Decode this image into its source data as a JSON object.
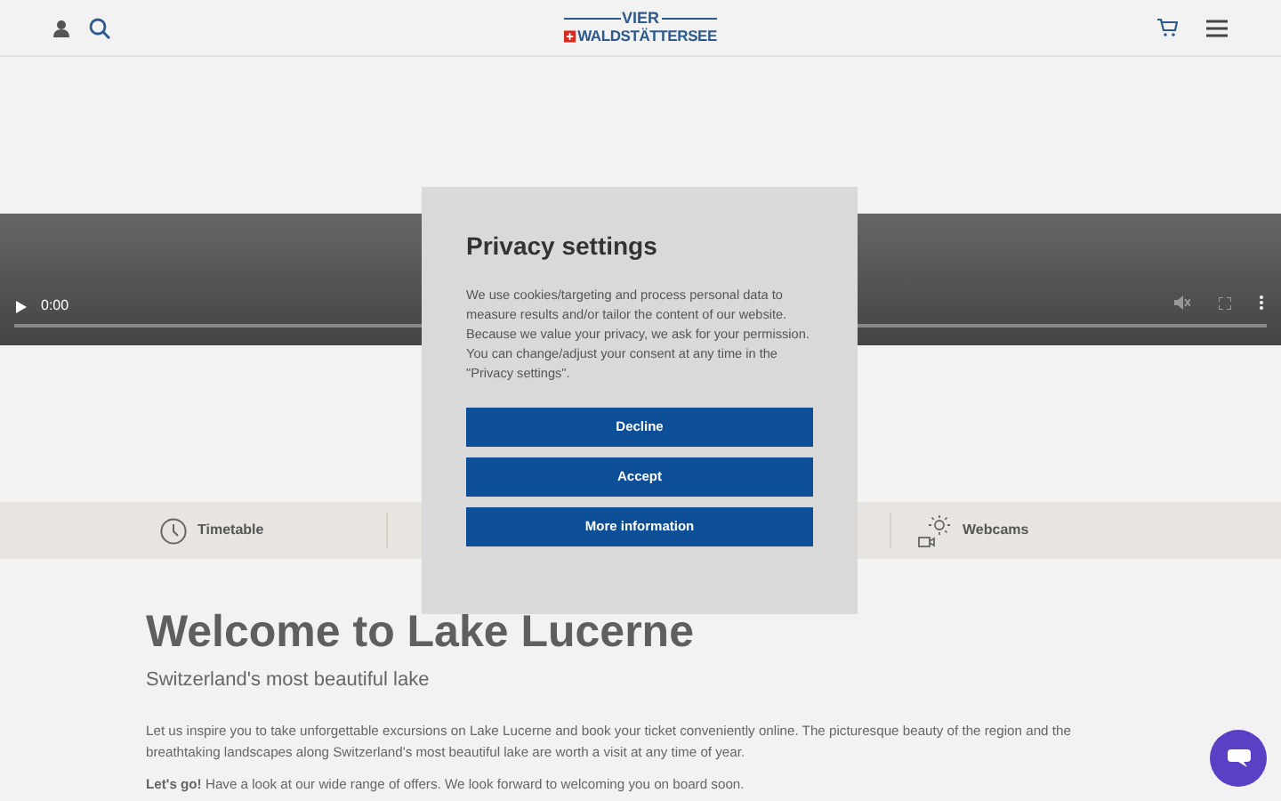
{
  "header": {
    "logo": {
      "top": "VIER",
      "bottom": "WALDSTÄTTERSEE"
    }
  },
  "video": {
    "time": "0:00"
  },
  "quick_links": [
    {
      "label": "Timetable"
    },
    {
      "label": "Webcams"
    }
  ],
  "content": {
    "title": "Welcome to Lake Lucerne",
    "subtitle": "Switzerland's most beautiful lake",
    "paragraphs": [
      "Let us inspire you to take unforgettable excursions on Lake Lucerne and book your ticket conveniently online. The picturesque beauty of the region and the breathtaking landscapes along Switzerland's most beautiful lake are worth a visit at any time of year.",
      "**Let's go!** Have a look at our wide range of offers. We look forward to welcoming you on board soon."
    ]
  },
  "privacy_dialog": {
    "title": "Privacy settings",
    "text": "We use cookies/targeting and process personal data to measure results and/or tailor the content of our website. Because we value your privacy, we ask for your permission. You can change/adjust your consent at any time in the \"Privacy settings\".",
    "buttons": [
      "Decline",
      "Accept",
      "More information"
    ]
  }
}
